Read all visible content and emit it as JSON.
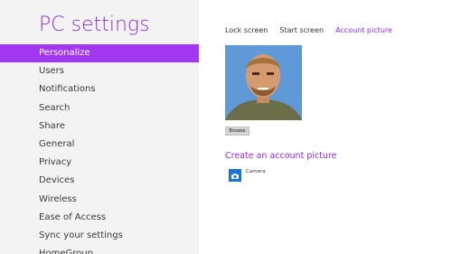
{
  "app": {
    "title": "PC settings"
  },
  "sidebar": {
    "items": [
      {
        "label": "Personalize",
        "active": true
      },
      {
        "label": "Users"
      },
      {
        "label": "Notifications"
      },
      {
        "label": "Search"
      },
      {
        "label": "Share"
      },
      {
        "label": "General"
      },
      {
        "label": "Privacy"
      },
      {
        "label": "Devices"
      },
      {
        "label": "Wireless"
      },
      {
        "label": "Ease of Access"
      },
      {
        "label": "Sync your settings"
      },
      {
        "label": "HomeGroup"
      }
    ]
  },
  "main": {
    "tabs": [
      {
        "label": "Lock screen"
      },
      {
        "label": "Start screen"
      },
      {
        "label": "Account picture",
        "active": true
      }
    ],
    "browse_label": "Browse",
    "create_heading": "Create an account picture",
    "apps": [
      {
        "label": "Camera",
        "icon": "camera-icon"
      }
    ]
  },
  "colors": {
    "accent": "#8d2be8",
    "selected_bg": "#a137f0",
    "sidebar_bg": "#f3f3f3",
    "app_tile": "#1a73d8"
  }
}
